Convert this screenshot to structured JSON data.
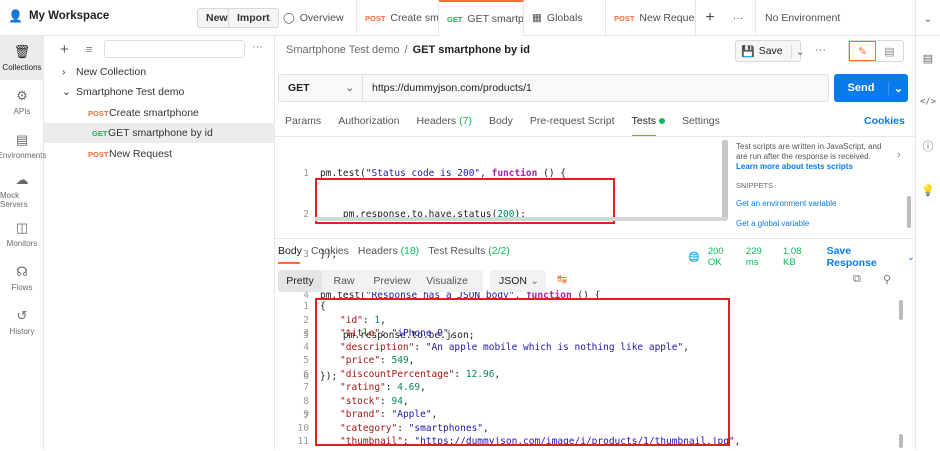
{
  "workspace": {
    "name": "My Workspace",
    "new_label": "New",
    "import_label": "Import"
  },
  "tabs": [
    {
      "method": "",
      "label": "Overview",
      "dot": false
    },
    {
      "method": "POST",
      "label": "Create sm",
      "dot": true
    },
    {
      "method": "GET",
      "label": "GET smartp",
      "dot": true
    },
    {
      "method": "",
      "label": "Globals",
      "dot": true
    },
    {
      "method": "POST",
      "label": "New Reques",
      "dot": false
    }
  ],
  "environment": "No Environment",
  "rail": [
    {
      "label": "Collections"
    },
    {
      "label": "APIs"
    },
    {
      "label": "Environments"
    },
    {
      "label": "Mock Servers"
    },
    {
      "label": "Monitors"
    },
    {
      "label": "Flows"
    },
    {
      "label": "History"
    }
  ],
  "tree": {
    "new_collection": "New Collection",
    "collection": "Smartphone Test demo",
    "items": [
      {
        "method": "POST",
        "label": "Create smartphone"
      },
      {
        "method": "GET",
        "label": "GET smartphone by id"
      },
      {
        "method": "POST",
        "label": "New Request"
      }
    ]
  },
  "breadcrumb": {
    "collection": "Smartphone Test demo",
    "sep": "/",
    "request": "GET smartphone by id"
  },
  "save_label": "Save",
  "request": {
    "method": "GET",
    "url": "https://dummyjson.com/products/1",
    "send": "Send"
  },
  "req_tabs": [
    "Params",
    "Authorization",
    "Headers",
    "(7)",
    "Body",
    "Pre-request Script",
    "Tests",
    "Settings"
  ],
  "cookies_label": "Cookies",
  "tests_code": {
    "line1a": "pm.test(",
    "line1b": "\"Status code is 200\"",
    "line1c": ", ",
    "line1d": "function",
    "line1e": " () {",
    "line2a": "    pm.response.to.have.status(",
    "line2b": "200",
    "line2c": ");",
    "line3": "});",
    "line4a": "pm.test(",
    "line4b": "\"Response has a JSON body\"",
    "line4c": ", ",
    "line4d": "function",
    "line4e": " () {",
    "line5": "    pm.response.to.be.json;",
    "line6": "});"
  },
  "tests_help": {
    "text": "Test scripts are written in JavaScript, and are run after the response is received.",
    "learn": "Learn more about tests scripts",
    "snippets": "SNIPPETS",
    "s1": "Get an environment variable",
    "s2": "Get a global variable"
  },
  "resp_tabs": {
    "body": "Body",
    "cookies": "Cookies",
    "headers": "Headers",
    "headers_count": "(18)",
    "tests": "Test Results",
    "tests_count": "(2/2)"
  },
  "status": {
    "code": "200 OK",
    "time": "229 ms",
    "size": "1.08 KB",
    "save": "Save Response"
  },
  "view_tabs": [
    "Pretty",
    "Raw",
    "Preview",
    "Visualize"
  ],
  "format": "JSON",
  "response": [
    {
      "n": "1",
      "k": "",
      "v": "{"
    },
    {
      "n": "2",
      "k": "\"id\"",
      "v": "1",
      "t": "num"
    },
    {
      "n": "3",
      "k": "\"title\"",
      "v": "\"iPhone 9\"",
      "t": "str"
    },
    {
      "n": "4",
      "k": "\"description\"",
      "v": "\"An apple mobile which is nothing like apple\"",
      "t": "str"
    },
    {
      "n": "5",
      "k": "\"price\"",
      "v": "549",
      "t": "num"
    },
    {
      "n": "6",
      "k": "\"discountPercentage\"",
      "v": "12.96",
      "t": "num"
    },
    {
      "n": "7",
      "k": "\"rating\"",
      "v": "4.69",
      "t": "num"
    },
    {
      "n": "8",
      "k": "\"stock\"",
      "v": "94",
      "t": "num"
    },
    {
      "n": "9",
      "k": "\"brand\"",
      "v": "\"Apple\"",
      "t": "str"
    },
    {
      "n": "10",
      "k": "\"category\"",
      "v": "\"smartphones\"",
      "t": "str"
    },
    {
      "n": "11",
      "k": "\"thumbnail\"",
      "v": "\"https://dummyjson.com/image/i/products/1/thumbnail.jpg\"",
      "t": "str"
    }
  ]
}
